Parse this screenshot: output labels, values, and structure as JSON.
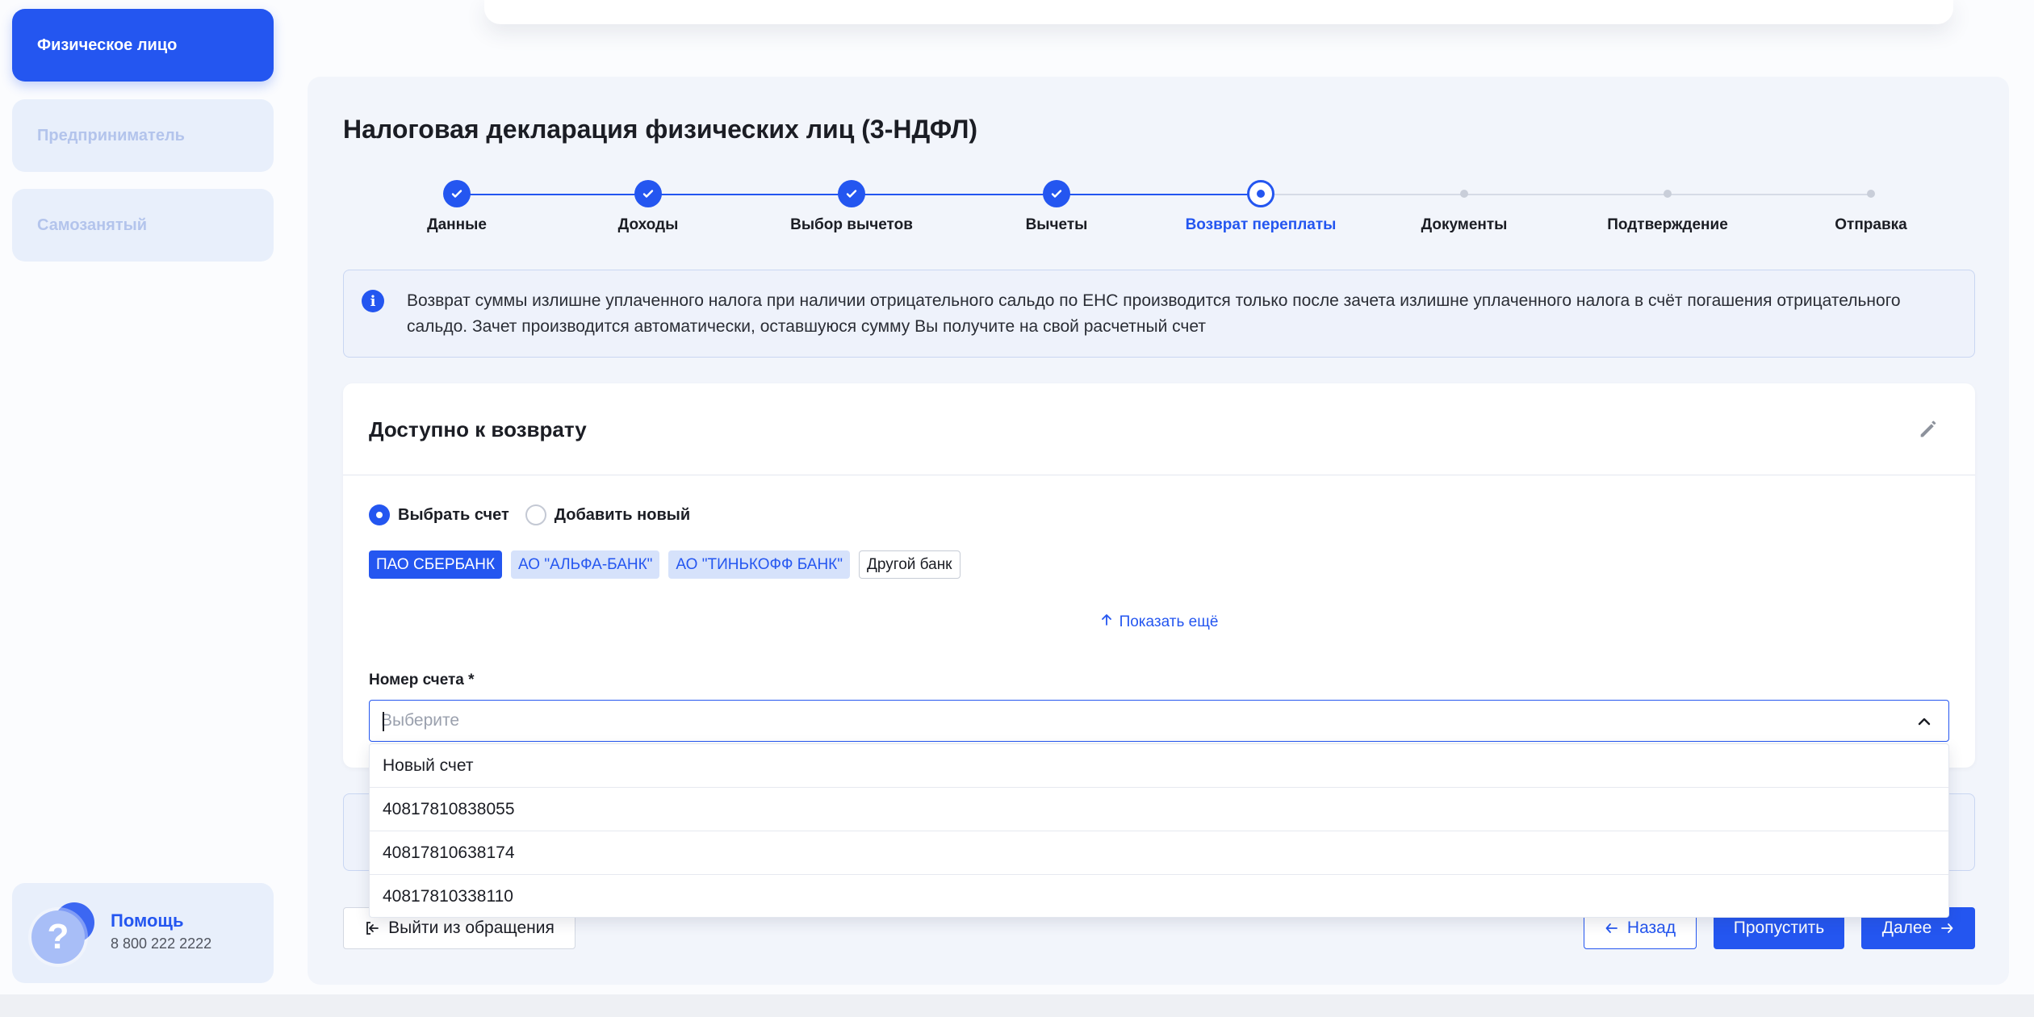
{
  "sidebar": {
    "tabs": [
      {
        "label": "Физическое лицо",
        "active": true
      },
      {
        "label": "Предприниматель",
        "active": false
      },
      {
        "label": "Самозанятый",
        "active": false
      }
    ],
    "help": {
      "title": "Помощь",
      "phone": "8 800 222 2222",
      "avatar_glyph": "?"
    }
  },
  "page": {
    "title": "Налоговая декларация физических лиц (3-НДФЛ)"
  },
  "stepper": {
    "steps": [
      {
        "label": "Данные",
        "state": "done"
      },
      {
        "label": "Доходы",
        "state": "done"
      },
      {
        "label": "Выбор вычетов",
        "state": "done"
      },
      {
        "label": "Вычеты",
        "state": "done"
      },
      {
        "label": "Возврат переплаты",
        "state": "current"
      },
      {
        "label": "Документы",
        "state": "todo"
      },
      {
        "label": "Подтверждение",
        "state": "todo"
      },
      {
        "label": "Отправка",
        "state": "todo"
      }
    ]
  },
  "info": {
    "icon": "info-icon",
    "text": "Возврат суммы излишне уплаченного налога при наличии отрицательного сальдо по ЕНС производится только после зачета излишне уплаченного налога в счёт погашения отрицательного сальдо. Зачет производится автоматически, оставшуюся сумму Вы получите на свой расчетный счет"
  },
  "refund": {
    "title": "Доступно к возврату",
    "radio_select": "Выбрать счет",
    "radio_add": "Добавить новый",
    "banks": [
      {
        "label": "ПАО СБЕРБАНК",
        "style": "active"
      },
      {
        "label": "АО \"АЛЬФА-БАНК\"",
        "style": "soft"
      },
      {
        "label": "АО \"ТИНЬКОФФ БАНК\"",
        "style": "soft"
      },
      {
        "label": "Другой банк",
        "style": "plain"
      }
    ],
    "show_more": "Показать ещё",
    "account_label": "Номер счета *",
    "account_placeholder": "Выберите",
    "account_options": [
      "Новый счет",
      "40817810838055",
      "40817810638174",
      "40817810338110"
    ]
  },
  "footer": {
    "exit": "Выйти из обращения",
    "back": "Назад",
    "skip": "Пропустить",
    "next": "Далее"
  },
  "colors": {
    "accent": "#2456f0",
    "panel": "#f2f5fb",
    "chip_soft": "#d6e2fb"
  }
}
